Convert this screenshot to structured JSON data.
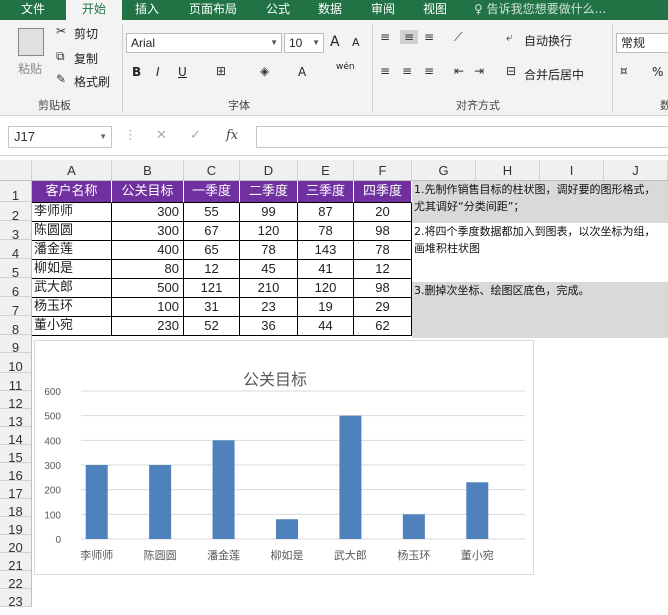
{
  "ribbon_tabs": [
    "文件",
    "开始",
    "插入",
    "页面布局",
    "公式",
    "数据",
    "审阅",
    "视图"
  ],
  "tell_me": "告诉我您想要做什么...",
  "clipboard": {
    "paste": "粘贴",
    "cut": "剪切",
    "copy": "复制",
    "painter": "格式刷",
    "label": "剪贴板"
  },
  "font": {
    "name": "Arial",
    "size": "10",
    "bold": "B",
    "italic": "I",
    "underline": "U",
    "label": "字体",
    "grow": "A",
    "shrink": "A",
    "wen": "wén"
  },
  "alignment": {
    "wrap": "自动换行",
    "merge": "合并后居中",
    "label": "对齐方式"
  },
  "number": {
    "format": "常规",
    "percent": "%",
    "label": "数"
  },
  "namebox": "J17",
  "fx_label": "fx",
  "columns": [
    "A",
    "B",
    "C",
    "D",
    "E",
    "F",
    "G",
    "H",
    "I",
    "J"
  ],
  "rows": [
    "1",
    "2",
    "3",
    "4",
    "5",
    "6",
    "7",
    "8",
    "9",
    "10",
    "11",
    "12",
    "13",
    "14",
    "15",
    "16",
    "17",
    "18",
    "19",
    "20",
    "21",
    "22",
    "23"
  ],
  "table": {
    "headers": [
      "客户名称",
      "公关目标",
      "一季度",
      "二季度",
      "三季度",
      "四季度"
    ],
    "data": [
      [
        "李师师",
        "300",
        "55",
        "99",
        "87",
        "20"
      ],
      [
        "陈圆圆",
        "300",
        "67",
        "120",
        "78",
        "98"
      ],
      [
        "潘金莲",
        "400",
        "65",
        "78",
        "143",
        "78"
      ],
      [
        "柳如是",
        "80",
        "12",
        "45",
        "41",
        "12"
      ],
      [
        "武大郎",
        "500",
        "121",
        "210",
        "120",
        "98"
      ],
      [
        "杨玉环",
        "100",
        "31",
        "23",
        "19",
        "29"
      ],
      [
        "董小宛",
        "230",
        "52",
        "36",
        "44",
        "62"
      ]
    ]
  },
  "notes": [
    "1.先制作销售目标的柱状图，调好要的图形格式，尤其调好“分类间距”；",
    "2.将四个季度数据都加入到图表，以次坐标为组，画堆积柱状图",
    "3.删掉次坐标、绘图区底色，完成。"
  ],
  "chart_data": {
    "type": "bar",
    "title": "公关目标",
    "categories": [
      "李师师",
      "陈圆圆",
      "潘金莲",
      "柳如是",
      "武大郎",
      "杨玉环",
      "董小宛"
    ],
    "values": [
      300,
      300,
      400,
      80,
      500,
      100,
      230
    ],
    "ylim": [
      0,
      600
    ],
    "yticks": [
      0,
      100,
      200,
      300,
      400,
      500,
      600
    ],
    "bar_color": "#4f81bd",
    "grid": true,
    "legend": "none"
  },
  "colors": {
    "excel_green": "#217346",
    "header_purple": "#7030a0"
  }
}
